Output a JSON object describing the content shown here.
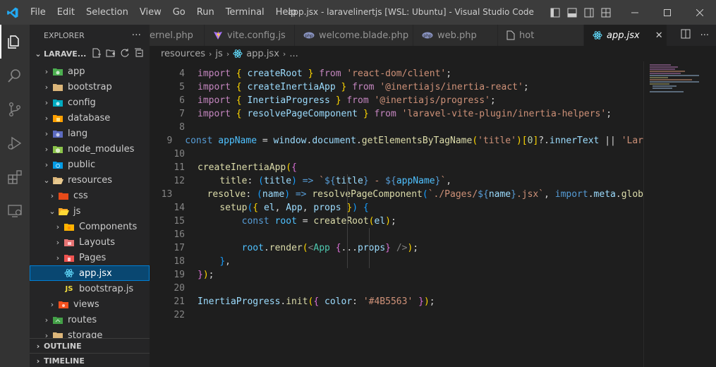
{
  "titlebar": {
    "menu": [
      "File",
      "Edit",
      "Selection",
      "View",
      "Go",
      "Run",
      "Terminal",
      "Help"
    ],
    "window_title": "app.jsx - laravelinertjs [WSL: Ubuntu] - Visual Studio Code"
  },
  "activity_bar": [
    "explorer-icon",
    "search-icon",
    "source-control-icon",
    "run-debug-icon",
    "extensions-icon",
    "remote-explorer-icon"
  ],
  "sidebar": {
    "title": "EXPLORER",
    "more": "···",
    "root": "LARAVE...",
    "items": [
      {
        "label": "app",
        "type": "folder"
      },
      {
        "label": "bootstrap",
        "type": "folder"
      },
      {
        "label": "config",
        "type": "folder"
      },
      {
        "label": "database",
        "type": "folder"
      },
      {
        "label": "lang",
        "type": "folder"
      },
      {
        "label": "node_modules",
        "type": "folder"
      },
      {
        "label": "public",
        "type": "folder"
      },
      {
        "label": "resources",
        "type": "folder-open"
      },
      {
        "label": "css",
        "type": "folder"
      },
      {
        "label": "js",
        "type": "folder-open"
      },
      {
        "label": "Components",
        "type": "folder"
      },
      {
        "label": "Layouts",
        "type": "folder"
      },
      {
        "label": "Pages",
        "type": "folder"
      },
      {
        "label": "app.jsx",
        "type": "react-file"
      },
      {
        "label": "bootstrap.js",
        "type": "js-file"
      },
      {
        "label": "views",
        "type": "folder"
      },
      {
        "label": "routes",
        "type": "folder"
      },
      {
        "label": "storage",
        "type": "folder"
      }
    ],
    "outline": "OUTLINE",
    "timeline": "TIMELINE"
  },
  "tabs": [
    {
      "label": "ernel.php",
      "icon": "php-icon"
    },
    {
      "label": "vite.config.js",
      "icon": "vite-icon"
    },
    {
      "label": "welcome.blade.php",
      "icon": "blade-icon"
    },
    {
      "label": "web.php",
      "icon": "php-icon"
    },
    {
      "label": "hot",
      "icon": "file-icon"
    },
    {
      "label": "app.jsx",
      "icon": "react-icon"
    }
  ],
  "breadcrumb": [
    "resources",
    "js",
    "app.jsx",
    "..."
  ],
  "code": {
    "line_numbers": [
      "4",
      "5",
      "6",
      "7",
      "8",
      "9",
      "10",
      "11",
      "12",
      "13",
      "14",
      "15",
      "16",
      "17",
      "18",
      "19",
      "20",
      "21",
      "22"
    ]
  },
  "colors": {
    "accent": "#007acc",
    "selection": "#094771",
    "keyword": "#569cd6",
    "string": "#ce9178",
    "function": "#dcdcaa"
  }
}
